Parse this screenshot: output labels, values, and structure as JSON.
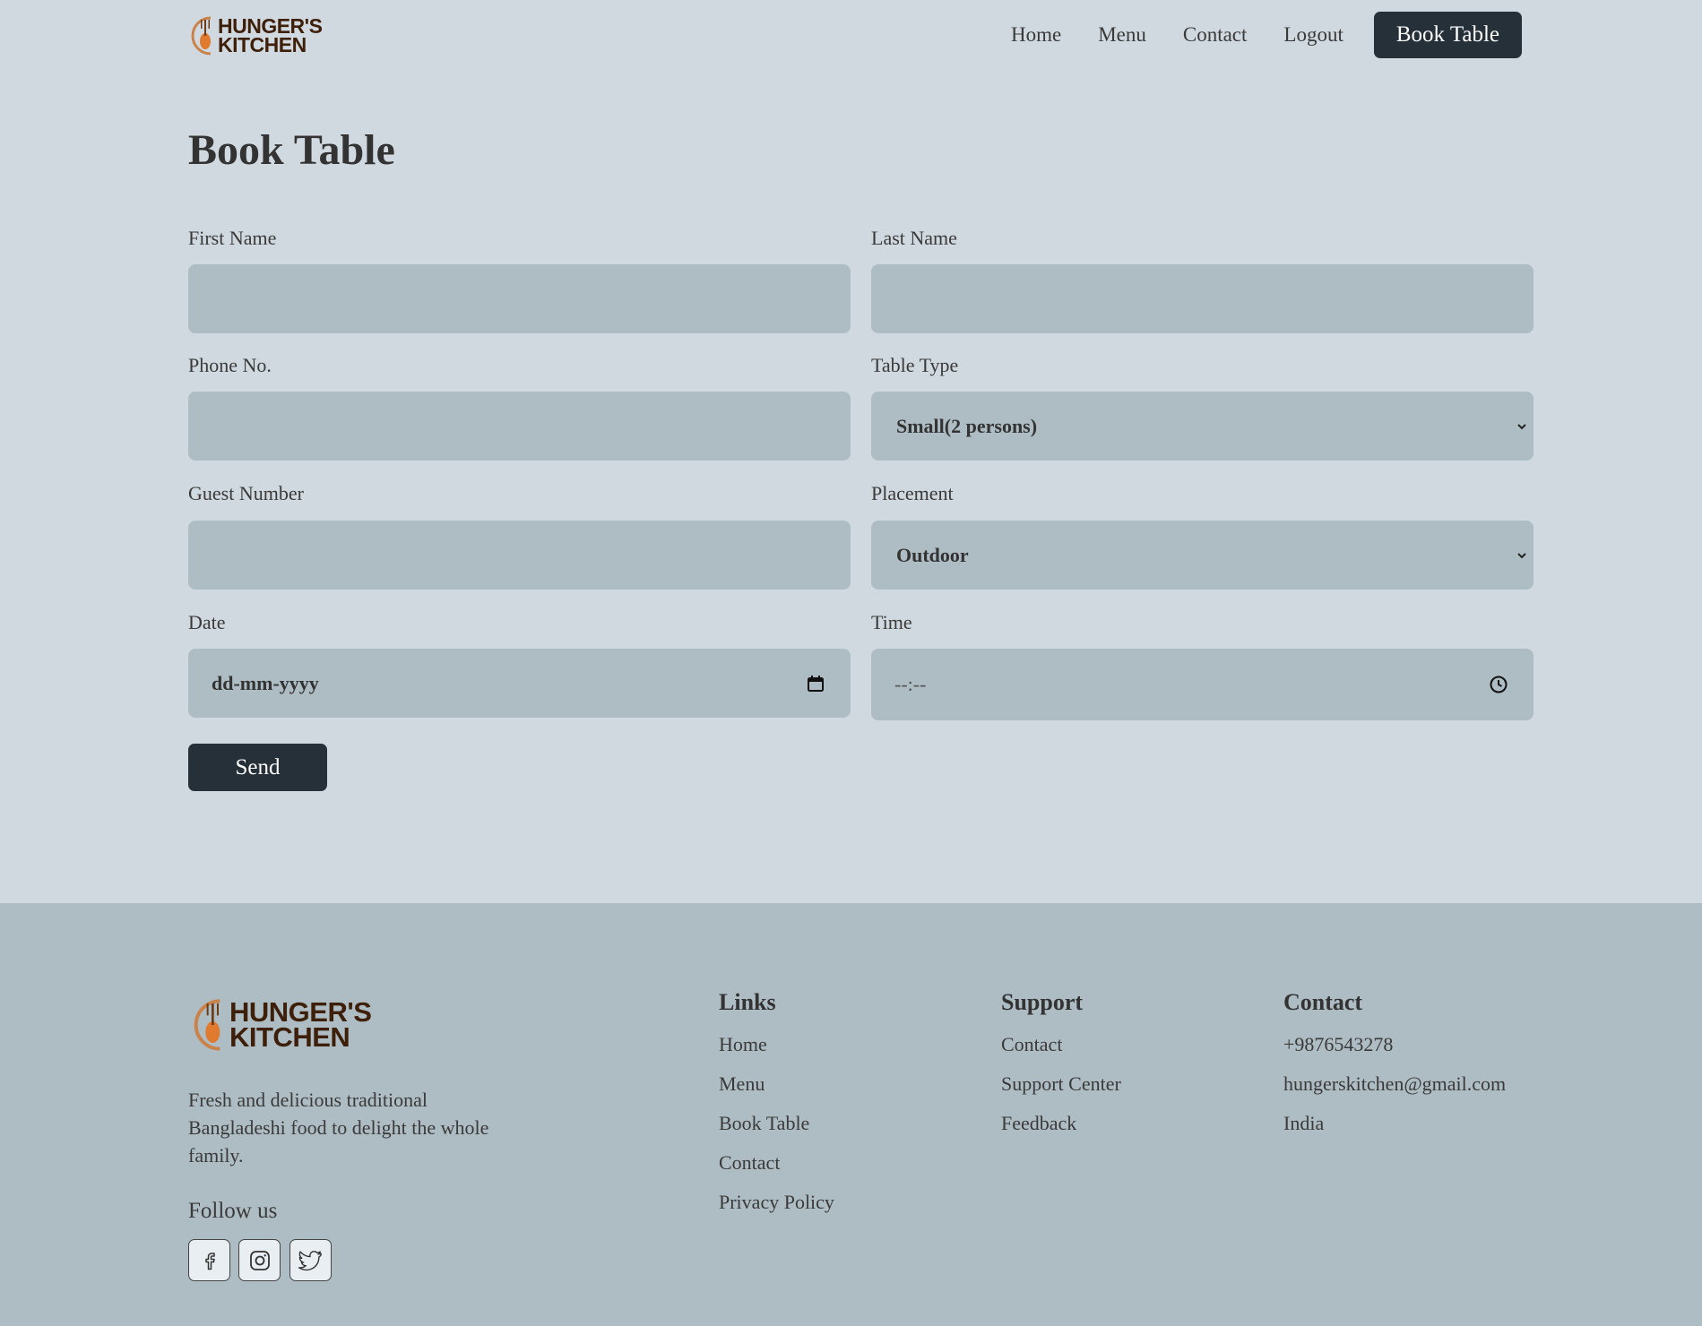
{
  "brand": {
    "line1": "HUNGER'S",
    "line2": "KITCHEN",
    "accent": "#e07a2f",
    "text_color": "#3d1f0a"
  },
  "nav": {
    "items": [
      "Home",
      "Menu",
      "Contact",
      "Logout"
    ],
    "cta": "Book Table"
  },
  "page": {
    "title": "Book Table"
  },
  "form": {
    "first_name": {
      "label": "First Name",
      "value": ""
    },
    "last_name": {
      "label": "Last Name",
      "value": ""
    },
    "phone": {
      "label": "Phone No.",
      "value": ""
    },
    "table_type": {
      "label": "Table Type",
      "selected": "Small(2 persons)"
    },
    "guest_number": {
      "label": "Guest Number",
      "value": ""
    },
    "placement": {
      "label": "Placement",
      "selected": "Outdoor"
    },
    "date": {
      "label": "Date",
      "placeholder": "dd-mm-yyyy"
    },
    "time": {
      "label": "Time",
      "placeholder": "--:--"
    },
    "submit": "Send"
  },
  "footer": {
    "description": "Fresh and delicious traditional Bangladeshi food to delight the whole family.",
    "follow_label": "Follow us",
    "social_icons": [
      "facebook-icon",
      "instagram-icon",
      "twitter-icon"
    ],
    "links": {
      "title": "Links",
      "items": [
        "Home",
        "Menu",
        "Book Table",
        "Contact",
        "Privacy Policy"
      ]
    },
    "support": {
      "title": "Support",
      "items": [
        "Contact",
        "Support Center",
        "Feedback"
      ]
    },
    "contact": {
      "title": "Contact",
      "items": [
        "+9876543278",
        "hungerskitchen@gmail.com",
        "India"
      ]
    }
  },
  "colors": {
    "page_bg": "#d0d9df",
    "field_bg": "#aebdc4",
    "footer_bg": "#aebdc4",
    "button_bg": "#253038"
  }
}
